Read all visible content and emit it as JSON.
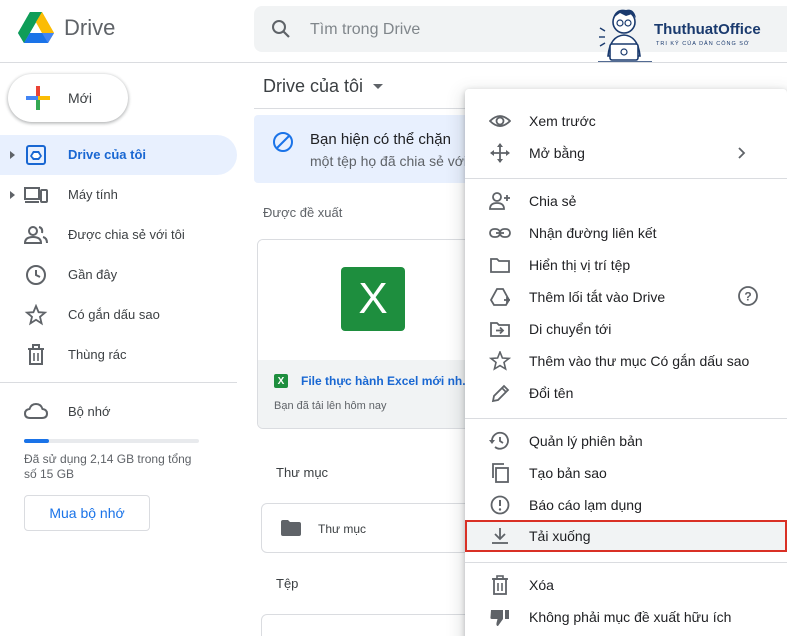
{
  "app": {
    "logo_text": "Drive",
    "search_placeholder": "Tìm trong Drive"
  },
  "watermark": {
    "name": "ThuthuatOffice",
    "tagline": "TRI KỶ CỦA DÂN CÔNG SỞ"
  },
  "sidebar": {
    "new_button": "Mới",
    "items": [
      {
        "label": "Drive của tôi",
        "icon": "my-drive-icon",
        "active": true
      },
      {
        "label": "Máy tính",
        "icon": "computer-icon",
        "active": false
      },
      {
        "label": "Được chia sẻ với tôi",
        "icon": "shared-people-icon",
        "active": false
      },
      {
        "label": "Gần đây",
        "icon": "clock-icon",
        "active": false
      },
      {
        "label": "Có gắn dấu sao",
        "icon": "star-icon",
        "active": false
      },
      {
        "label": "Thùng rác",
        "icon": "trash-icon",
        "active": false
      }
    ],
    "storage": {
      "label": "Bộ nhớ",
      "usage_text": "Đã sử dụng 2,14 GB trong tổng số 15 GB",
      "used_fraction": 0.143,
      "buy_button": "Mua bộ nhớ"
    }
  },
  "main": {
    "title": "Drive của tôi",
    "banner": {
      "line1": "Bạn hiện có thể chặn",
      "line2": "một tệp họ đã chia sẻ với"
    },
    "suggested_label": "Được đề xuất",
    "suggested_file": {
      "name": "File thực hành Excel mới nh...",
      "subtitle": "Bạn đã tải lên hôm nay"
    },
    "folders_label": "Thư mục",
    "folder_name": "Thư mục",
    "files_label": "Tệp"
  },
  "context_menu": {
    "groups": [
      [
        {
          "label": "Xem trước",
          "icon": "eye-icon"
        },
        {
          "label": "Mở bằng",
          "icon": "move-arrows-icon",
          "submenu": true
        }
      ],
      [
        {
          "label": "Chia sẻ",
          "icon": "person-add-icon"
        },
        {
          "label": "Nhận đường liên kết",
          "icon": "link-icon"
        },
        {
          "label": "Hiển thị vị trí tệp",
          "icon": "folder-icon"
        },
        {
          "label": "Thêm lối tắt vào Drive",
          "icon": "drive-shortcut-icon",
          "help": true
        },
        {
          "label": "Di chuyển tới",
          "icon": "move-to-icon"
        },
        {
          "label": "Thêm vào thư mục Có gắn dấu sao",
          "icon": "star-outline-icon"
        },
        {
          "label": "Đổi tên",
          "icon": "pencil-icon"
        }
      ],
      [
        {
          "label": "Quản lý phiên bản",
          "icon": "history-icon"
        },
        {
          "label": "Tạo bản sao",
          "icon": "copy-icon"
        },
        {
          "label": "Báo cáo lạm dụng",
          "icon": "report-icon"
        },
        {
          "label": "Tải xuống",
          "icon": "download-icon",
          "highlighted": true
        }
      ],
      [
        {
          "label": "Xóa",
          "icon": "trash-icon"
        },
        {
          "label": "Không phải mục đề xuất hữu ích",
          "icon": "thumbs-down-icon"
        }
      ]
    ]
  },
  "colors": {
    "accent": "#1a73e8",
    "active_nav_bg": "#e8f0fe",
    "highlight_border": "#d93025",
    "excel_green": "#1e8e3e"
  }
}
